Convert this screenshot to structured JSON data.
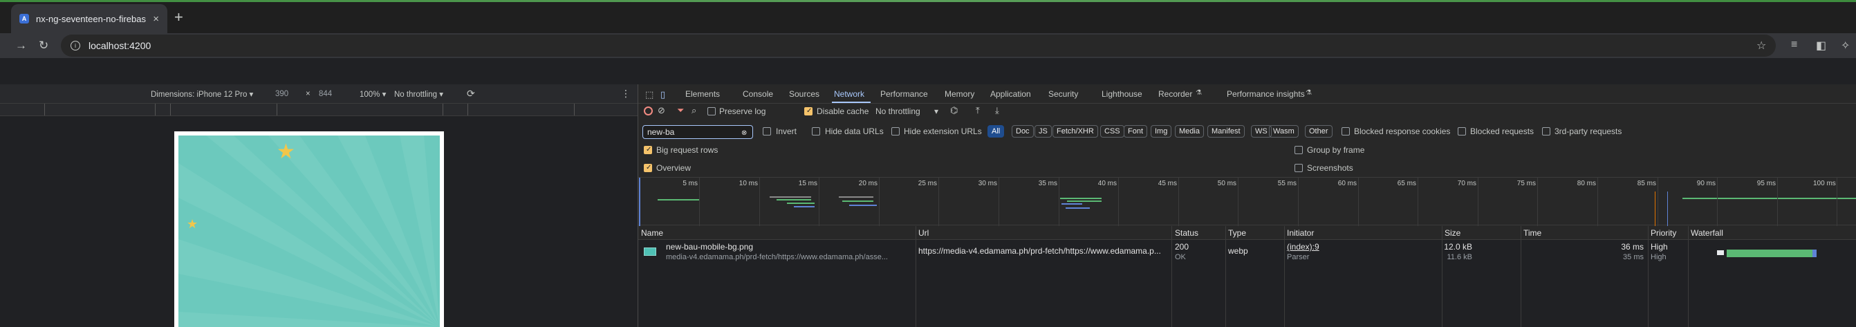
{
  "browser": {
    "tab_title": "nx-ng-seventeen-no-firebase",
    "tab_close": "×",
    "new_tab": "+",
    "url": "localhost:4200",
    "accent": "#3d8b3d"
  },
  "device_toolbar": {
    "dimensions_label": "Dimensions: iPhone 12 Pro ▾",
    "width": "390",
    "times": "×",
    "height": "844",
    "zoom": "100% ▾",
    "throttling": "No throttling ▾",
    "menu": "⋮"
  },
  "devtools": {
    "tabs": [
      "Elements",
      "Console",
      "Sources",
      "Network",
      "Performance",
      "Memory",
      "Application",
      "Security",
      "Lighthouse",
      "Recorder",
      "Performance insights"
    ],
    "active_tab": "Network",
    "toolbar": {
      "preserve_log": "Preserve log",
      "disable_cache": "Disable cache",
      "throttling": "No throttling",
      "throttling_arrow": "▾"
    },
    "filter": {
      "value": "new-ba",
      "invert": "Invert",
      "hide_data_urls": "Hide data URLs",
      "hide_extension_urls": "Hide extension URLs",
      "types": [
        "All",
        "Doc",
        "JS",
        "Fetch/XHR",
        "CSS",
        "Font",
        "Img",
        "Media",
        "Manifest",
        "WS",
        "Wasm",
        "Other"
      ],
      "selected_type": "All",
      "blocked_cookies": "Blocked response cookies",
      "blocked_requests": "Blocked requests",
      "third_party": "3rd-party requests"
    },
    "settings": {
      "big_request_rows": "Big request rows",
      "group_by_frame": "Group by frame",
      "overview": "Overview",
      "screenshots": "Screenshots"
    },
    "overview_ticks": [
      "5 ms",
      "10 ms",
      "15 ms",
      "20 ms",
      "25 ms",
      "30 ms",
      "35 ms",
      "40 ms",
      "45 ms",
      "50 ms",
      "55 ms",
      "60 ms",
      "65 ms",
      "70 ms",
      "75 ms",
      "80 ms",
      "85 ms",
      "90 ms",
      "95 ms",
      "100 ms"
    ],
    "columns": [
      "Name",
      "Url",
      "Status",
      "Type",
      "Initiator",
      "Size",
      "Time",
      "Priority",
      "Waterfall"
    ],
    "rows": [
      {
        "name": "new-bau-mobile-bg.png",
        "name_sub": "media-v4.edamama.ph/prd-fetch/https://www.edamama.ph/asse...",
        "url": "https://media-v4.edamama.ph/prd-fetch/https://www.edamama.p...",
        "status": "200",
        "status_text": "OK",
        "type": "webp",
        "initiator": "(index):9",
        "initiator_sub": "Parser",
        "size": "12.0 kB",
        "size_sub": "11.6 kB",
        "time": "36 ms",
        "time_sub": "35 ms",
        "priority": "High",
        "priority_sub": "High"
      }
    ]
  }
}
